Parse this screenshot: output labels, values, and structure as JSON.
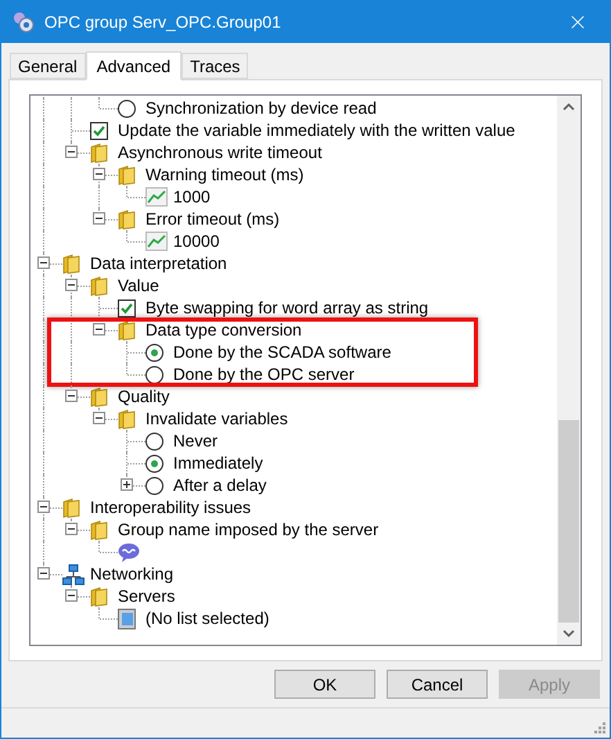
{
  "window": {
    "title": "OPC group Serv_OPC.Group01"
  },
  "tabs": [
    {
      "label": "General",
      "selected": false
    },
    {
      "label": "Advanced",
      "selected": true
    },
    {
      "label": "Traces",
      "selected": false
    }
  ],
  "tree": [
    {
      "children": [
        {
          "children": [
            {
              "kind": "radio",
              "label": "Synchronization by device read",
              "selected": false
            }
          ]
        },
        {
          "kind": "checkbox",
          "label": "Update the variable immediately with the written value",
          "checked": true
        },
        {
          "kind": "folder",
          "label": "Asynchronous write timeout",
          "expanded": true,
          "children": [
            {
              "kind": "folder",
              "label": "Warning timeout (ms)",
              "expanded": true,
              "children": [
                {
                  "kind": "number",
                  "label": "1000"
                }
              ]
            },
            {
              "kind": "folder",
              "label": "Error timeout (ms)",
              "expanded": true,
              "children": [
                {
                  "kind": "number",
                  "label": "10000"
                }
              ]
            }
          ]
        }
      ]
    },
    {
      "kind": "folder",
      "label": "Data interpretation",
      "expanded": true,
      "children": [
        {
          "kind": "folder",
          "label": "Value",
          "expanded": true,
          "children": [
            {
              "kind": "checkbox",
              "label": "Byte swapping for word array as string",
              "checked": true
            },
            {
              "kind": "folder",
              "label": "Data type conversion",
              "expanded": true,
              "highlighted": true,
              "children": [
                {
                  "kind": "radio",
                  "label": "Done by the SCADA software",
                  "selected": true
                },
                {
                  "kind": "radio",
                  "label": "Done by the OPC server",
                  "selected": false
                }
              ]
            }
          ]
        },
        {
          "kind": "folder",
          "label": "Quality",
          "expanded": true,
          "children": [
            {
              "kind": "folder",
              "label": "Invalidate variables",
              "expanded": true,
              "children": [
                {
                  "kind": "radio",
                  "label": "Never",
                  "selected": false
                },
                {
                  "kind": "radio",
                  "label": "Immediately",
                  "selected": true
                },
                {
                  "kind": "radio",
                  "label": "After a delay",
                  "selected": false,
                  "expanded": false
                }
              ]
            }
          ]
        }
      ]
    },
    {
      "kind": "folder",
      "label": "Interoperability issues",
      "expanded": true,
      "children": [
        {
          "kind": "folder",
          "label": "Group name imposed by the server",
          "expanded": true,
          "children": [
            {
              "kind": "text-value"
            }
          ]
        }
      ]
    },
    {
      "kind": "network",
      "label": "Networking",
      "expanded": true,
      "children": [
        {
          "kind": "folder",
          "label": "Servers",
          "expanded": true,
          "children": [
            {
              "kind": "list",
              "label": "(No list selected)"
            }
          ]
        }
      ]
    }
  ],
  "buttons": [
    {
      "label": "OK",
      "disabled": false
    },
    {
      "label": "Cancel",
      "disabled": false
    },
    {
      "label": "Apply",
      "disabled": true
    }
  ]
}
